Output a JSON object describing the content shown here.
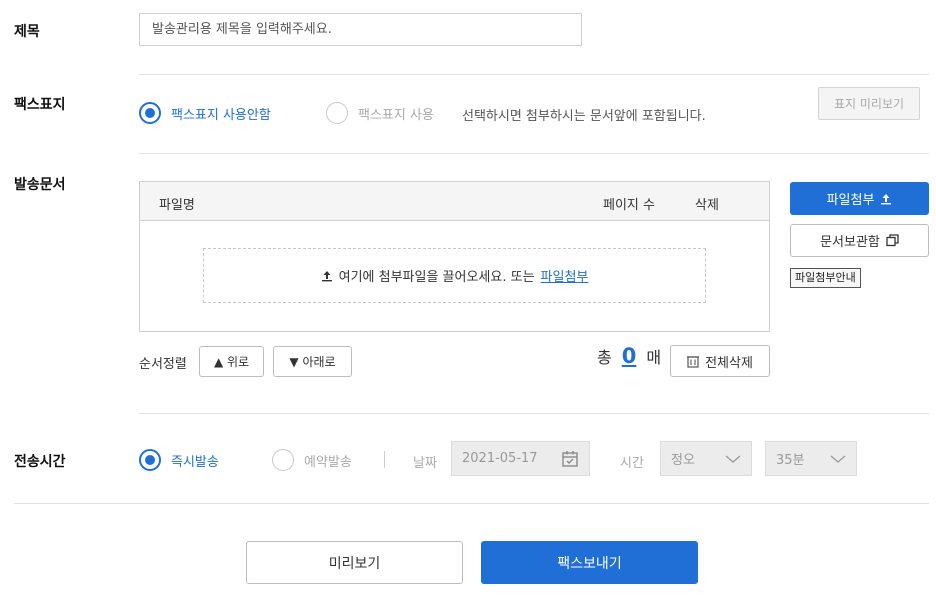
{
  "labels": {
    "subject": "제목",
    "fax_cover": "팩스표지",
    "documents": "발송문서",
    "send_time": "전송시간"
  },
  "subject_input": {
    "placeholder": "발송관리용 제목을 입력해주세요."
  },
  "fax_cover": {
    "option_none": "팩스표지 사용안함",
    "option_use": "팩스표지 사용",
    "hint": "선택하시면 첨부하시는 문서앞에 포함됩니다.",
    "preview_button": "표지 미리보기",
    "selected": "option_none"
  },
  "documents": {
    "columns": {
      "filename": "파일명",
      "pages": "페이지 수",
      "delete": "삭제"
    },
    "dropzone_text": "여기에 첨부파일을 끌어오세요. 또는",
    "dropzone_link": "파일첨부",
    "attach_button": "파일첨부",
    "storage_button": "문서보관함",
    "guide_tag": "파일첨부안내",
    "sort_label": "순서정렬",
    "up_button": "▲ 위로",
    "down_button": "▼ 아래로",
    "count_prefix": "총",
    "count_value": "0",
    "count_suffix": "매",
    "delete_all_button": "전체삭제"
  },
  "send_time": {
    "option_now": "즉시발송",
    "option_schedule": "예약발송",
    "selected": "option_now",
    "date_label": "날짜",
    "date_value": "2021-05-17",
    "time_label": "시간",
    "hour_value": "정오",
    "minute_value": "35분"
  },
  "footer": {
    "preview_button": "미리보기",
    "send_button": "팩스보내기"
  },
  "colors": {
    "accent": "#1f6fd6",
    "border": "#cfcfcf",
    "disabled_bg": "#ececec"
  }
}
